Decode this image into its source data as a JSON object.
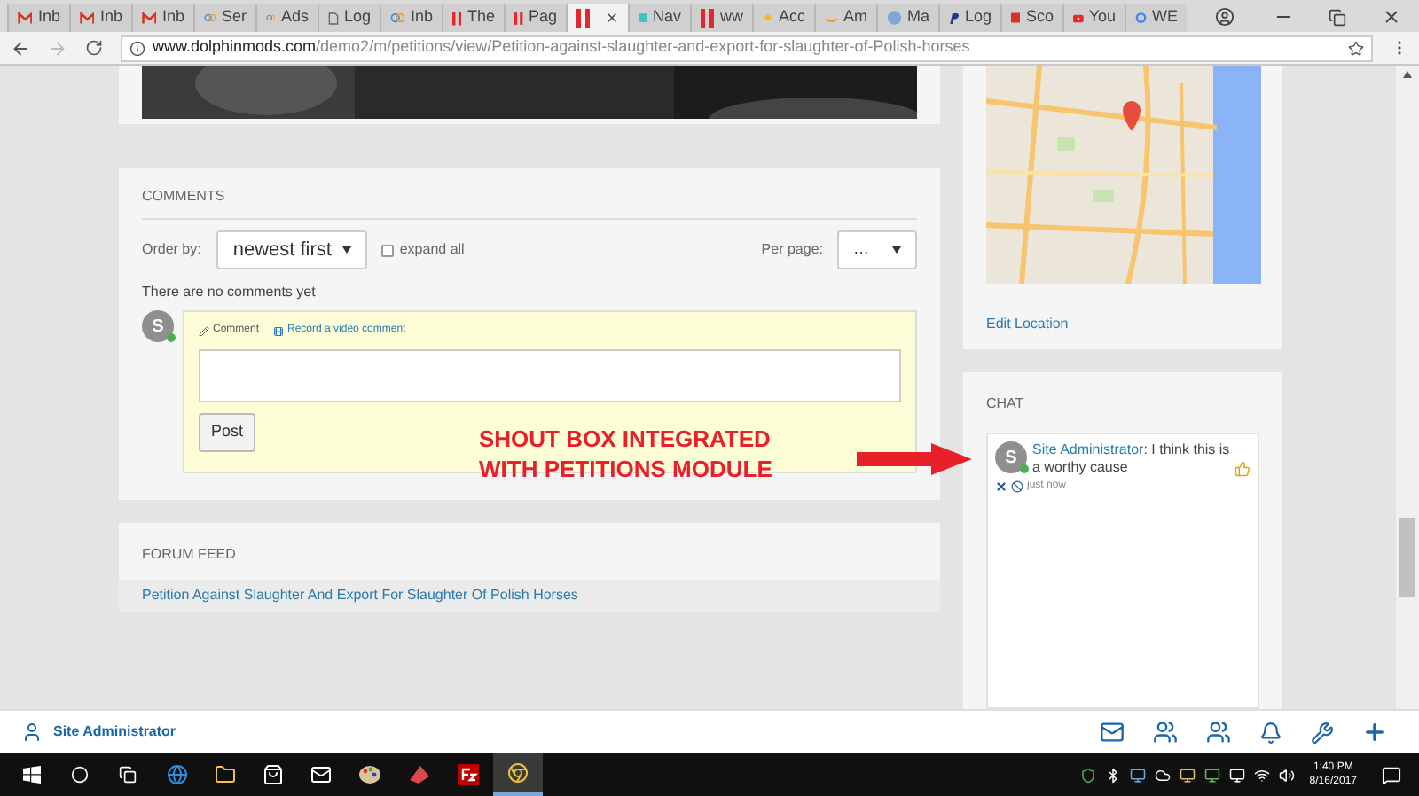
{
  "browser": {
    "tabs": [
      {
        "label": "Inb",
        "kind": "mail",
        "selected": false
      },
      {
        "label": "Inb",
        "kind": "mail",
        "selected": false
      },
      {
        "label": "Inb",
        "kind": "mail",
        "selected": false
      },
      {
        "label": "Ser",
        "kind": "rings",
        "selected": false
      },
      {
        "label": "Ads",
        "kind": "rings",
        "selected": false
      },
      {
        "label": "Log",
        "kind": "page",
        "selected": false
      },
      {
        "label": "Inb",
        "kind": "rings",
        "selected": false
      },
      {
        "label": "The",
        "kind": "bars",
        "selected": false
      },
      {
        "label": "Pag",
        "kind": "bars",
        "selected": false
      },
      {
        "kind": "bars",
        "selected": true
      },
      {
        "label": "Nav",
        "kind": "square",
        "selected": false
      },
      {
        "label": "ww",
        "kind": "bars",
        "selected": false
      },
      {
        "label": "Acc",
        "kind": "sun",
        "selected": false
      },
      {
        "label": "Am",
        "kind": "smile",
        "selected": false
      },
      {
        "label": "Ma",
        "kind": "globe",
        "selected": false
      },
      {
        "label": "Log",
        "kind": "paypal",
        "selected": false
      },
      {
        "label": "Sco",
        "kind": "redsquare",
        "selected": false
      },
      {
        "label": "You",
        "kind": "play",
        "selected": false
      },
      {
        "label": "WE",
        "kind": "ring",
        "selected": false
      }
    ],
    "url_domain": "www.dolphinmods.com",
    "url_path": "/demo2/m/petitions/view/Petition-against-slaughter-and-export-for-slaughter-of-Polish-horses"
  },
  "comments": {
    "title": "COMMENTS",
    "order_label": "Order by:",
    "order_value": "newest first",
    "expand_label": "expand all",
    "expand_checked": false,
    "per_page_label": "Per page:",
    "per_page_value": "…",
    "empty_text": "There are no comments yet",
    "avatar_letter": "S",
    "online": true,
    "tabs": [
      {
        "label": "Comment",
        "selected": true
      },
      {
        "label": "Record a video comment",
        "selected": false
      }
    ],
    "post_button": "Post"
  },
  "annotation": {
    "lines": [
      "SHOUT BOX INTEGRATED",
      "WITH PETITIONS MODULE"
    ]
  },
  "forum_feed": {
    "title": "FORUM FEED",
    "items": [
      "Petition Against Slaughter And Export For Slaughter Of Polish Horses"
    ]
  },
  "location": {
    "edit_link": "Edit Location"
  },
  "chat": {
    "title": "CHAT",
    "messages": [
      {
        "author": "Site Administrator",
        "text": ": I think this is a worthy cause",
        "avatar_letter": "S",
        "online": true,
        "time": "just now"
      }
    ]
  },
  "bottom_bar": {
    "user": "Site Administrator"
  },
  "taskbar": {
    "time": "1:40 PM",
    "date": "8/16/2017"
  }
}
